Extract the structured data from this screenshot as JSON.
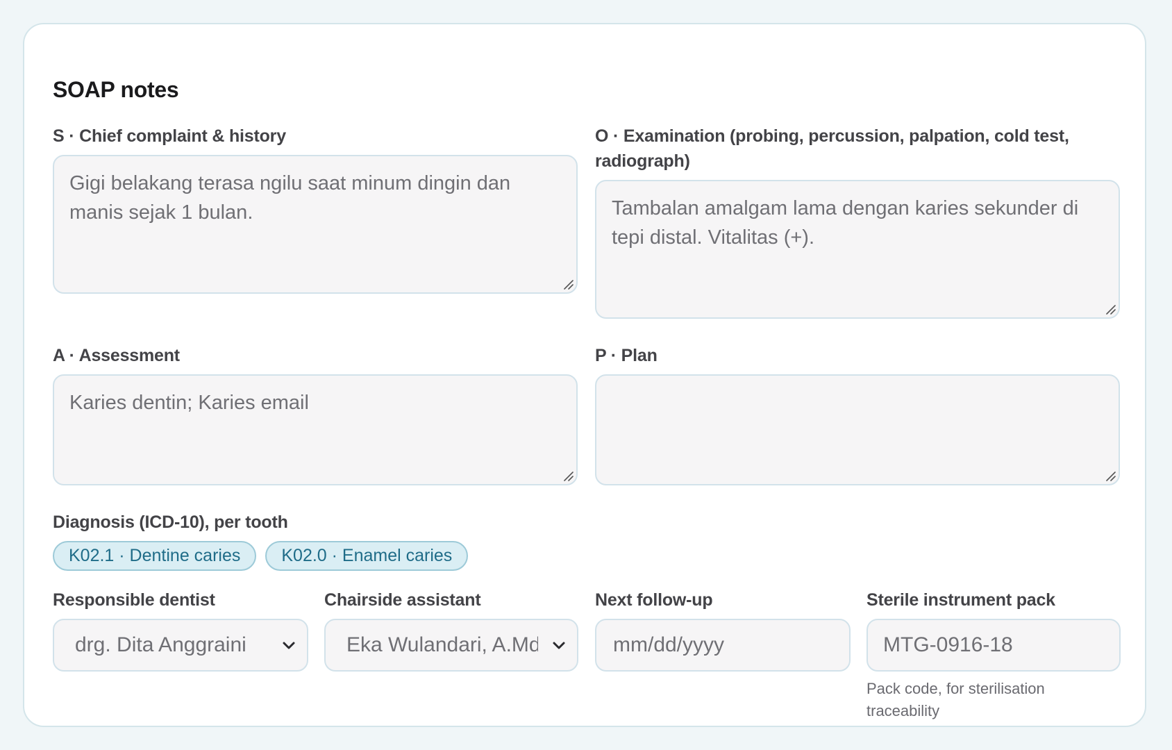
{
  "card": {
    "title": "SOAP notes"
  },
  "soap": {
    "subjective": {
      "label": "S · Chief complaint & history",
      "value": "Gigi belakang terasa ngilu saat minum dingin dan manis sejak 1 bulan."
    },
    "objective": {
      "label": "O · Examination (probing, percussion, palpation, cold test, radiograph)",
      "value": "Tambalan amalgam lama dengan karies sekunder di tepi distal. Vitalitas (+)."
    },
    "assessment": {
      "label": "A · Assessment",
      "value": "Karies dentin; Karies email"
    },
    "plan": {
      "label": "P · Plan",
      "value": ""
    }
  },
  "diagnosis": {
    "label": "Diagnosis (ICD-10), per tooth",
    "chips": [
      "K02.1 · Dentine caries",
      "K02.0 · Enamel caries"
    ]
  },
  "footer_fields": {
    "dentist": {
      "label": "Responsible dentist",
      "value": "drg. Dita Anggraini"
    },
    "assistant": {
      "label": "Chairside assistant",
      "value": "Eka Wulandari, A.Md.K"
    },
    "followup": {
      "label": "Next follow-up",
      "placeholder": "mm/dd/yyyy"
    },
    "pack": {
      "label": "Sterile instrument pack",
      "value": "MTG-0916-18",
      "hint": "Pack code, for sterilisation traceability"
    }
  },
  "icons": {
    "resize": "resize-grip-icon",
    "dropdown": "chevron-down-icon"
  }
}
